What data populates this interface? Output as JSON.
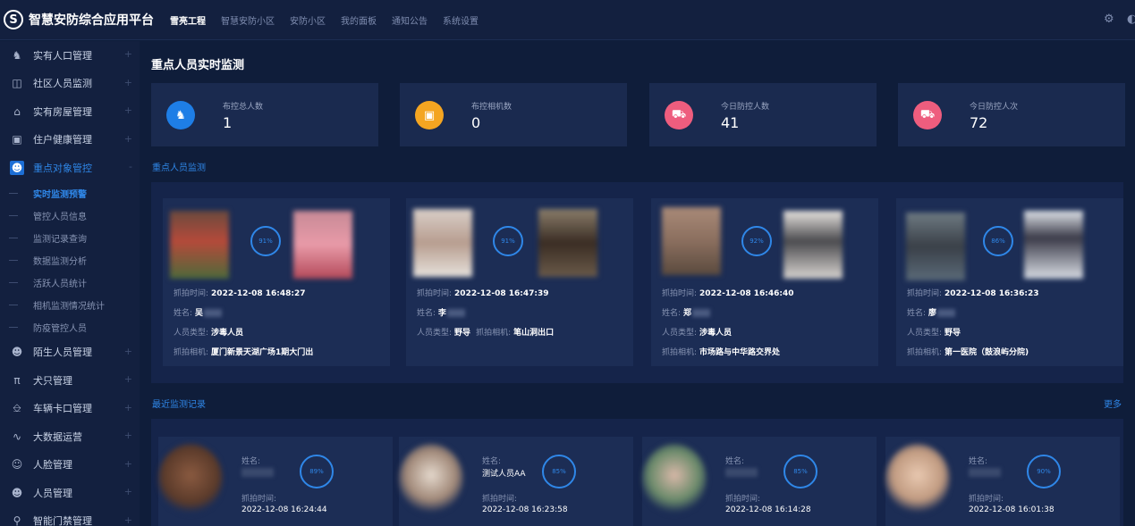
{
  "app": {
    "logo_glyph": "S",
    "title": "智慧安防综合应用平台"
  },
  "topnav": [
    {
      "label": "雪亮工程",
      "active": true
    },
    {
      "label": "智慧安防小区",
      "active": false
    },
    {
      "label": "安防小区",
      "active": false
    },
    {
      "label": "我的面板",
      "active": false
    },
    {
      "label": "通知公告",
      "active": false
    },
    {
      "label": "系统设置",
      "active": false
    }
  ],
  "sidebar": {
    "items": [
      {
        "label": "实有人口管理",
        "icon": "users-icon"
      },
      {
        "label": "社区人员监测",
        "icon": "camera-icon"
      },
      {
        "label": "实有房屋管理",
        "icon": "home-icon"
      },
      {
        "label": "住户健康管理",
        "icon": "medical-kit-icon"
      },
      {
        "label": "重点对象管控",
        "icon": "person-icon"
      },
      {
        "label": "陌生人员管理",
        "icon": "person-icon"
      },
      {
        "label": "犬只管理",
        "icon": "dog-icon"
      },
      {
        "label": "车辆卡口管理",
        "icon": "gate-icon"
      },
      {
        "label": "大数据运营",
        "icon": "trend-icon"
      },
      {
        "label": "人脸管理",
        "icon": "face-icon"
      },
      {
        "label": "人员管理",
        "icon": "person-icon"
      },
      {
        "label": "智能门禁管理",
        "icon": "lock-icon"
      }
    ],
    "sub_items": [
      {
        "label": "实时监测预警",
        "active": true
      },
      {
        "label": "管控人员信息",
        "active": false
      },
      {
        "label": "监测记录查询",
        "active": false
      },
      {
        "label": "数据监测分析",
        "active": false
      },
      {
        "label": "活跃人员统计",
        "active": false
      },
      {
        "label": "相机监测情况统计",
        "active": false
      },
      {
        "label": "防疫管控人员",
        "active": false
      }
    ],
    "plus": "+",
    "minus": "-"
  },
  "page_title": "重点人员实时监测",
  "stats": [
    {
      "label": "布控总人数",
      "value": "1",
      "color": "#1e7ee6",
      "icon": "users-icon"
    },
    {
      "label": "布控相机数",
      "value": "0",
      "color": "#f4a521",
      "icon": "camera-icon"
    },
    {
      "label": "今日防控人数",
      "value": "41",
      "color": "#ee5d7e",
      "icon": "car-icon"
    },
    {
      "label": "今日防控人次",
      "value": "72",
      "color": "#ee5d7e",
      "icon": "car-icon"
    }
  ],
  "monitor": {
    "title": "重点人员监测",
    "labels": {
      "time": "抓拍时间:",
      "name": "姓名:",
      "type": "人员类型:",
      "camera": "抓拍相机:"
    },
    "cards": [
      {
        "percent": "91%",
        "time": "2022-12-08 16:48:27",
        "name": "吴",
        "type": "涉毒人员",
        "camera": "厦门新景天湖广场1期大门出"
      },
      {
        "percent": "91%",
        "time": "2022-12-08 16:47:39",
        "name": "李",
        "type": "野导",
        "camera": "笔山洞出口"
      },
      {
        "percent": "92%",
        "time": "2022-12-08 16:46:40",
        "name": "郑",
        "type": "涉毒人员",
        "camera": "市场路与中华路交界处"
      },
      {
        "percent": "86%",
        "time": "2022-12-08 16:36:23",
        "name": "廖",
        "type": "野导",
        "camera": "第一医院（鼓浪屿分院)"
      }
    ]
  },
  "records": {
    "title": "最近监测记录",
    "more": "更多",
    "labels": {
      "name": "姓名:",
      "time": "抓拍时间:"
    },
    "cards": [
      {
        "percent": "89%",
        "name": "",
        "time": "2022-12-08 16:24:44"
      },
      {
        "percent": "85%",
        "name": "测试人员AA",
        "time": "2022-12-08 16:23:58"
      },
      {
        "percent": "85%",
        "name": "",
        "time": "2022-12-08 16:14:28"
      },
      {
        "percent": "90%",
        "name": "",
        "time": "2022-12-08 16:01:38"
      }
    ]
  }
}
